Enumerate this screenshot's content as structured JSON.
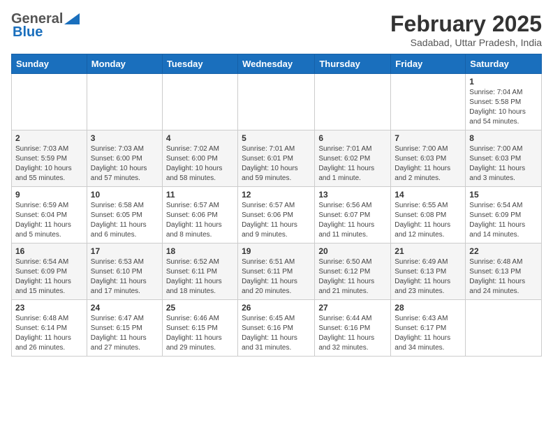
{
  "header": {
    "logo_general": "General",
    "logo_blue": "Blue",
    "month": "February 2025",
    "location": "Sadabad, Uttar Pradesh, India"
  },
  "weekdays": [
    "Sunday",
    "Monday",
    "Tuesday",
    "Wednesday",
    "Thursday",
    "Friday",
    "Saturday"
  ],
  "weeks": [
    [
      {
        "day": "",
        "info": ""
      },
      {
        "day": "",
        "info": ""
      },
      {
        "day": "",
        "info": ""
      },
      {
        "day": "",
        "info": ""
      },
      {
        "day": "",
        "info": ""
      },
      {
        "day": "",
        "info": ""
      },
      {
        "day": "1",
        "info": "Sunrise: 7:04 AM\nSunset: 5:58 PM\nDaylight: 10 hours and 54 minutes."
      }
    ],
    [
      {
        "day": "2",
        "info": "Sunrise: 7:03 AM\nSunset: 5:59 PM\nDaylight: 10 hours and 55 minutes."
      },
      {
        "day": "3",
        "info": "Sunrise: 7:03 AM\nSunset: 6:00 PM\nDaylight: 10 hours and 57 minutes."
      },
      {
        "day": "4",
        "info": "Sunrise: 7:02 AM\nSunset: 6:00 PM\nDaylight: 10 hours and 58 minutes."
      },
      {
        "day": "5",
        "info": "Sunrise: 7:01 AM\nSunset: 6:01 PM\nDaylight: 10 hours and 59 minutes."
      },
      {
        "day": "6",
        "info": "Sunrise: 7:01 AM\nSunset: 6:02 PM\nDaylight: 11 hours and 1 minute."
      },
      {
        "day": "7",
        "info": "Sunrise: 7:00 AM\nSunset: 6:03 PM\nDaylight: 11 hours and 2 minutes."
      },
      {
        "day": "8",
        "info": "Sunrise: 7:00 AM\nSunset: 6:03 PM\nDaylight: 11 hours and 3 minutes."
      }
    ],
    [
      {
        "day": "9",
        "info": "Sunrise: 6:59 AM\nSunset: 6:04 PM\nDaylight: 11 hours and 5 minutes."
      },
      {
        "day": "10",
        "info": "Sunrise: 6:58 AM\nSunset: 6:05 PM\nDaylight: 11 hours and 6 minutes."
      },
      {
        "day": "11",
        "info": "Sunrise: 6:57 AM\nSunset: 6:06 PM\nDaylight: 11 hours and 8 minutes."
      },
      {
        "day": "12",
        "info": "Sunrise: 6:57 AM\nSunset: 6:06 PM\nDaylight: 11 hours and 9 minutes."
      },
      {
        "day": "13",
        "info": "Sunrise: 6:56 AM\nSunset: 6:07 PM\nDaylight: 11 hours and 11 minutes."
      },
      {
        "day": "14",
        "info": "Sunrise: 6:55 AM\nSunset: 6:08 PM\nDaylight: 11 hours and 12 minutes."
      },
      {
        "day": "15",
        "info": "Sunrise: 6:54 AM\nSunset: 6:09 PM\nDaylight: 11 hours and 14 minutes."
      }
    ],
    [
      {
        "day": "16",
        "info": "Sunrise: 6:54 AM\nSunset: 6:09 PM\nDaylight: 11 hours and 15 minutes."
      },
      {
        "day": "17",
        "info": "Sunrise: 6:53 AM\nSunset: 6:10 PM\nDaylight: 11 hours and 17 minutes."
      },
      {
        "day": "18",
        "info": "Sunrise: 6:52 AM\nSunset: 6:11 PM\nDaylight: 11 hours and 18 minutes."
      },
      {
        "day": "19",
        "info": "Sunrise: 6:51 AM\nSunset: 6:11 PM\nDaylight: 11 hours and 20 minutes."
      },
      {
        "day": "20",
        "info": "Sunrise: 6:50 AM\nSunset: 6:12 PM\nDaylight: 11 hours and 21 minutes."
      },
      {
        "day": "21",
        "info": "Sunrise: 6:49 AM\nSunset: 6:13 PM\nDaylight: 11 hours and 23 minutes."
      },
      {
        "day": "22",
        "info": "Sunrise: 6:48 AM\nSunset: 6:13 PM\nDaylight: 11 hours and 24 minutes."
      }
    ],
    [
      {
        "day": "23",
        "info": "Sunrise: 6:48 AM\nSunset: 6:14 PM\nDaylight: 11 hours and 26 minutes."
      },
      {
        "day": "24",
        "info": "Sunrise: 6:47 AM\nSunset: 6:15 PM\nDaylight: 11 hours and 27 minutes."
      },
      {
        "day": "25",
        "info": "Sunrise: 6:46 AM\nSunset: 6:15 PM\nDaylight: 11 hours and 29 minutes."
      },
      {
        "day": "26",
        "info": "Sunrise: 6:45 AM\nSunset: 6:16 PM\nDaylight: 11 hours and 31 minutes."
      },
      {
        "day": "27",
        "info": "Sunrise: 6:44 AM\nSunset: 6:16 PM\nDaylight: 11 hours and 32 minutes."
      },
      {
        "day": "28",
        "info": "Sunrise: 6:43 AM\nSunset: 6:17 PM\nDaylight: 11 hours and 34 minutes."
      },
      {
        "day": "",
        "info": ""
      }
    ]
  ]
}
